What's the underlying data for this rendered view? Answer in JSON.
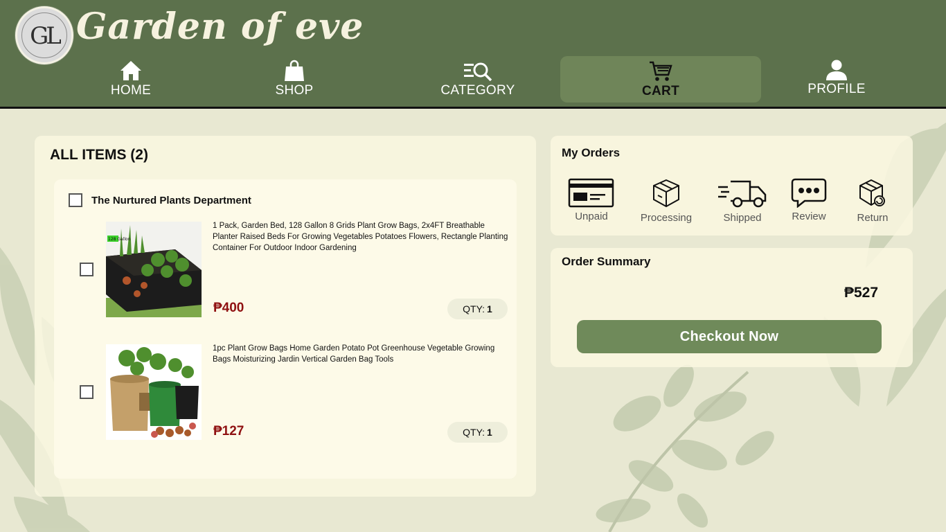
{
  "brand": {
    "name": "Garden of eve",
    "logo_monogram": "GL",
    "logo_ring_text": "GARDEN OF EVE"
  },
  "nav": {
    "items": [
      {
        "label": "HOME",
        "icon": "home-icon"
      },
      {
        "label": "SHOP",
        "icon": "shopping-bag-icon"
      },
      {
        "label": "CATEGORY",
        "icon": "category-search-icon"
      },
      {
        "label": "CART",
        "icon": "cart-icon",
        "active": true
      },
      {
        "label": "PROFILE",
        "icon": "user-icon"
      }
    ]
  },
  "cart": {
    "title": "ALL ITEMS (2)",
    "store": {
      "name": "The Nurtured Plants Department",
      "products": [
        {
          "description": "1 Pack, Garden Bed, 128 Gallon 8 Grids Plant Grow Bags, 2x4FT Breathable Planter Raised Beds For Growing Vegetables Potatoes Flowers, Rectangle Planting Container For Outdoor Indoor Gardening",
          "price": "₱400",
          "qty_label": "QTY:",
          "qty": "1",
          "image_badge": "128 Gallon"
        },
        {
          "description": "1pc Plant Grow Bags Home Garden Potato Pot Greenhouse Vegetable Growing Bags Moisturizing Jardin Vertical Garden Bag Tools",
          "price": "₱127",
          "qty_label": "QTY:",
          "qty": "1"
        }
      ]
    }
  },
  "orders": {
    "title": "My Orders",
    "statuses": [
      {
        "label": "Unpaid",
        "icon": "credit-card-icon"
      },
      {
        "label": "Processing",
        "icon": "package-icon"
      },
      {
        "label": "Shipped",
        "icon": "delivery-truck-icon"
      },
      {
        "label": "Review",
        "icon": "chat-bubble-icon"
      },
      {
        "label": "Return",
        "icon": "return-package-icon"
      }
    ]
  },
  "summary": {
    "title": "Order Summary",
    "total": "₱527",
    "checkout_label": "Checkout Now"
  },
  "colors": {
    "header": "#5c714c",
    "nav_active": "#6f8559",
    "price": "#8f1111",
    "checkout": "#6f8a5a",
    "background": "#e8e8d2",
    "panel": "#fdfae8"
  }
}
